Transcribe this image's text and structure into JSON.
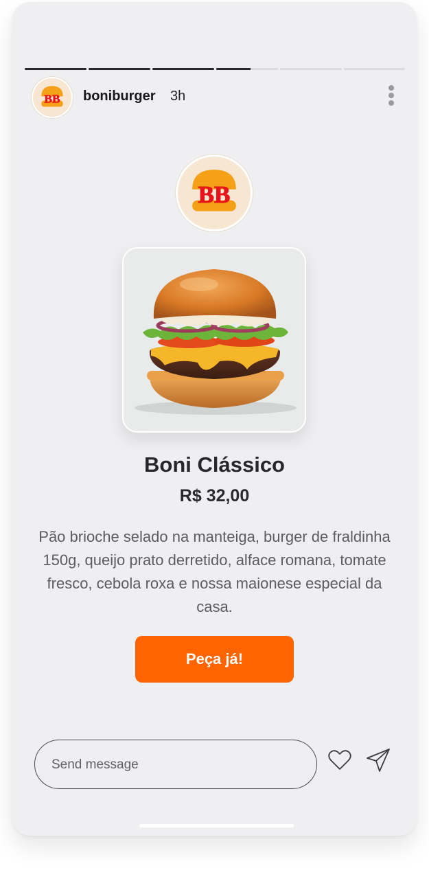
{
  "story": {
    "segments": [
      {
        "progress": 1.0
      },
      {
        "progress": 1.0
      },
      {
        "progress": 1.0
      },
      {
        "progress": 0.56
      },
      {
        "progress": 0.0
      },
      {
        "progress": 0.0
      }
    ]
  },
  "header": {
    "username": "boniburger",
    "time": "3h",
    "logo_text": "BB"
  },
  "product": {
    "name": "Boni Clássico",
    "price": "R$ 32,00",
    "description": "Pão brioche selado na manteiga, burger de fraldinha 150g, queijo prato derretido, alface romana, tomate fresco, cebola roxa e nossa maionese especial da casa.",
    "cta_label": "Peça já!"
  },
  "reply": {
    "placeholder": "Send message"
  },
  "icons": {
    "more": "more-vertical-icon",
    "like": "heart-icon",
    "send": "paper-plane-icon"
  },
  "colors": {
    "accent": "#ff6400",
    "logo_red": "#e8141b",
    "background": "#efeff2"
  }
}
